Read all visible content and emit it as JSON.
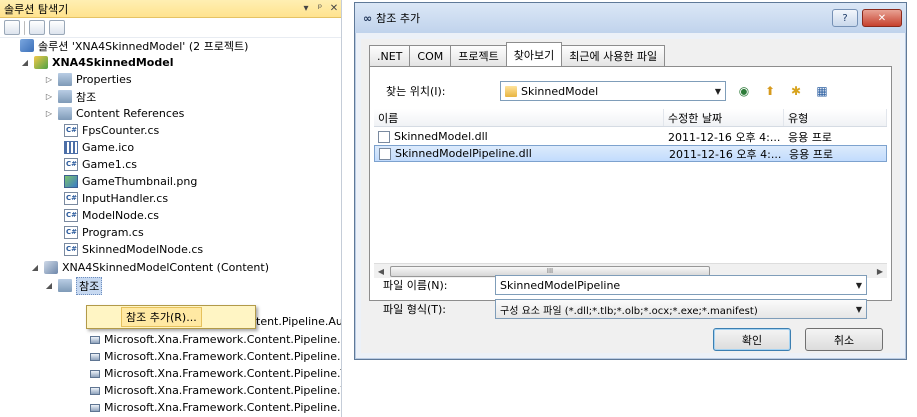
{
  "solution_explorer": {
    "title": "솔루션 탐색기",
    "title_controls": [
      "▾",
      "ᵖ",
      "✕"
    ],
    "items": [
      {
        "label": "솔루션 'XNA4SkinnedModel' (2 프로젝트)",
        "icon": "solution-icon"
      },
      {
        "label": "XNA4SkinnedModel",
        "icon": "project-icon"
      },
      {
        "label": "Properties",
        "icon": "properties-icon"
      },
      {
        "label": "참조",
        "icon": "references-folder-icon"
      },
      {
        "label": "Content References",
        "icon": "content-references-icon"
      },
      {
        "label": "FpsCounter.cs",
        "icon": "csharp-file-icon"
      },
      {
        "label": "Game.ico",
        "icon": "ico-file-icon"
      },
      {
        "label": "Game1.cs",
        "icon": "csharp-file-icon"
      },
      {
        "label": "GameThumbnail.png",
        "icon": "png-file-icon"
      },
      {
        "label": "InputHandler.cs",
        "icon": "csharp-file-icon"
      },
      {
        "label": "ModelNode.cs",
        "icon": "csharp-file-icon"
      },
      {
        "label": "Program.cs",
        "icon": "csharp-file-icon"
      },
      {
        "label": "SkinnedModelNode.cs",
        "icon": "csharp-file-icon"
      },
      {
        "label": "XNA4SkinnedModelContent (Content)",
        "icon": "content-project-icon"
      },
      {
        "label": "참조",
        "icon": "references-folder-icon"
      },
      {
        "label": "tent.Pipeline.Au",
        "icon": "reference-icon"
      },
      {
        "label": "Microsoft.Xna.Framework.Content.Pipeline.Ef",
        "icon": "reference-icon"
      },
      {
        "label": "Microsoft.Xna.Framework.Content.Pipeline.FE",
        "icon": "reference-icon"
      },
      {
        "label": "Microsoft.Xna.Framework.Content.Pipeline.Te",
        "icon": "reference-icon"
      },
      {
        "label": "Microsoft.Xna.Framework.Content.Pipeline.Vi",
        "icon": "reference-icon"
      },
      {
        "label": "Microsoft.Xna.Framework.Content.Pipeline.XI",
        "icon": "reference-icon"
      }
    ],
    "context_menu": {
      "item": "참조 추가(R)..."
    }
  },
  "dialog": {
    "title": "참조 추가",
    "help_button": "?",
    "close_button": "✕",
    "tabs": [
      ".NET",
      "COM",
      "프로젝트",
      "찾아보기",
      "최근에 사용한 파일"
    ],
    "active_tab_index": 3,
    "look_in_label": "찾는 위치(I):",
    "look_in_value": "SkinnedModel",
    "columns": [
      "이름",
      "수정한 날짜",
      "유형"
    ],
    "files": [
      {
        "name": "SkinnedModel.dll",
        "date": "2011-12-16 오후 4:...",
        "type": "응용 프로"
      },
      {
        "name": "SkinnedModelPipeline.dll",
        "date": "2011-12-16 오후 4:...",
        "type": "응용 프로"
      }
    ],
    "selected_file_index": 1,
    "scroll_grip": "III",
    "file_name_label": "파일 이름(N):",
    "file_name_value": "SkinnedModelPipeline",
    "file_type_label": "파일 형식(T):",
    "file_type_value": "구성 요소 파일 (*.dll;*.tlb;*.olb;*.ocx;*.exe;*.manifest)",
    "ok_button": "확인",
    "cancel_button": "취소"
  }
}
